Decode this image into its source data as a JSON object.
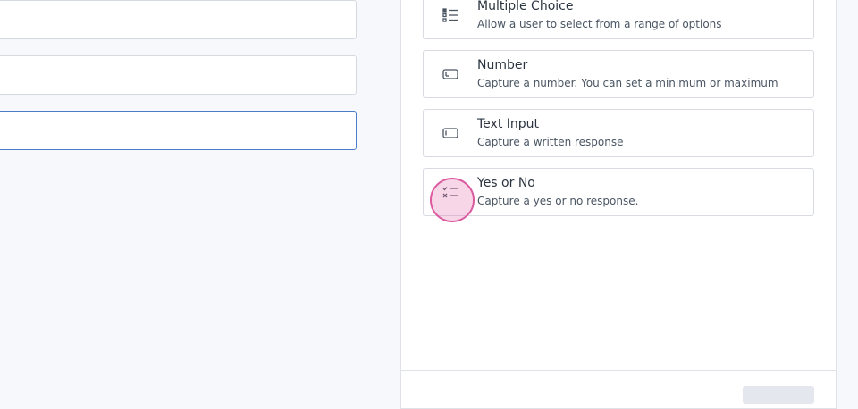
{
  "fields": [
    {
      "value": "",
      "focused": false
    },
    {
      "value": "",
      "focused": false
    },
    {
      "value": "",
      "focused": true
    }
  ],
  "options": [
    {
      "title": "Multiple Choice",
      "description": "Allow a user to select from a range of options",
      "icon": "list-icon"
    },
    {
      "title": "Number",
      "description": "Capture a number. You can set a minimum or maximum",
      "icon": "number-input-icon"
    },
    {
      "title": "Text Input",
      "description": "Capture a written response",
      "icon": "text-input-icon"
    },
    {
      "title": "Yes or No",
      "description": "Capture a yes or no response.",
      "icon": "check-cross-list-icon"
    }
  ],
  "colors": {
    "background": "#f6f8fb",
    "focus_border": "#4a7cc9",
    "click_marker": "#dc5a9f"
  }
}
